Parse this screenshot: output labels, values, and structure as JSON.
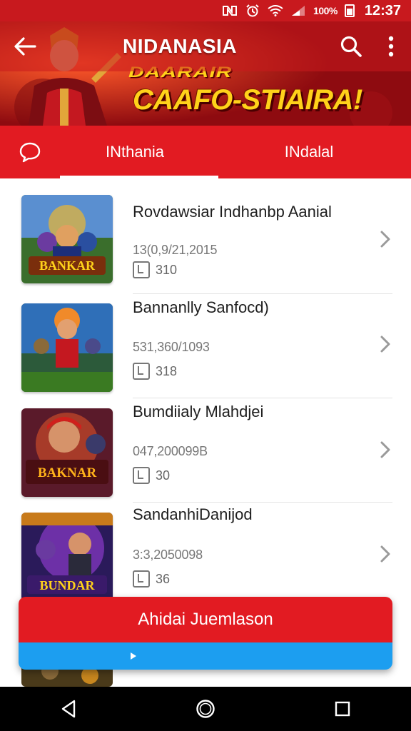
{
  "status_bar": {
    "battery_text": "100%",
    "time": "12:37",
    "icons": [
      "nfc-icon",
      "alarm-icon",
      "wifi-icon",
      "signal-icon",
      "battery-icon"
    ]
  },
  "toolbar": {
    "title": "NIDANASIA",
    "back_icon": "arrow-left-icon",
    "search_icon": "search-icon",
    "more_icon": "more-vert-icon"
  },
  "hero": {
    "line1": "DAARAIR",
    "line2": "CAAFO-STIAIRA!"
  },
  "tabs": {
    "items": [
      {
        "label": "INthania"
      },
      {
        "label": "INdalal"
      }
    ]
  },
  "list": {
    "items": [
      {
        "title": "Rovdawsiar Indhanbp Aanial",
        "date": "13(0,9/21,2015",
        "count": "310"
      },
      {
        "title": "Bannanlly Sanfocd)",
        "date": "531,360/1093",
        "count": "318"
      },
      {
        "title": "Bumdiialy Mlahdjei",
        "date": "047,200099B",
        "count": "30"
      },
      {
        "title": "SandanhiDanijod",
        "date": "3:3,2050098",
        "count": "36"
      }
    ],
    "thumb_captions": [
      "BANKAR",
      "",
      "BAKNAR",
      "BUNDAR"
    ]
  },
  "action": {
    "label": "Ahidai Juemlason"
  },
  "colors": {
    "brand_red": "#e21b22",
    "status_red": "#c8191e",
    "accent_blue": "#1c9ef0",
    "banner_yellow": "#ffd21a"
  }
}
